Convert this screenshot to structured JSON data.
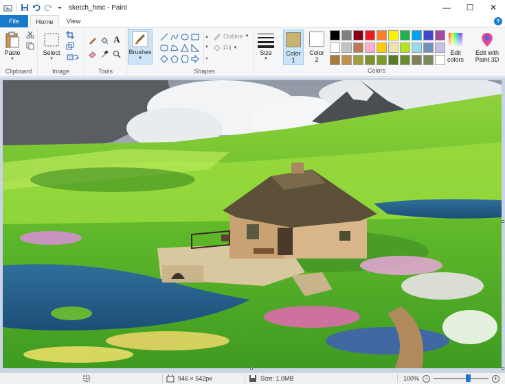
{
  "window": {
    "title": "sketch_hmc - Paint",
    "controls": {
      "minimize": "—",
      "maximize": "☐",
      "close": "✕"
    }
  },
  "quick_access": [
    "paint-app-icon",
    "save-icon",
    "undo-icon",
    "redo-icon",
    "customize-dropdown-icon"
  ],
  "tabs": {
    "file": "File",
    "home": "Home",
    "view": "View"
  },
  "help_glyph": "?",
  "ribbon": {
    "clipboard": {
      "label": "Clipboard",
      "paste": "Paste"
    },
    "image": {
      "label": "Image",
      "select": "Select"
    },
    "tools": {
      "label": "Tools"
    },
    "brushes": {
      "label": "Brushes"
    },
    "shapes": {
      "label": "Shapes",
      "outline": "Outline",
      "fill": "Fill"
    },
    "size": {
      "label": "Size"
    },
    "color1": {
      "label": "Color",
      "number": "1",
      "value": "#c8b46e"
    },
    "color2": {
      "label": "Color",
      "number": "2",
      "value": "#ffffff"
    },
    "colors": {
      "label": "Colors",
      "edit_line1": "Edit",
      "edit_line2": "colors"
    },
    "paint3d": {
      "line1": "Edit with",
      "line2": "Paint 3D"
    }
  },
  "palette": {
    "row1": [
      "#000000",
      "#7f7f7f",
      "#880015",
      "#ed1c24",
      "#ff7f27",
      "#fff200",
      "#22b14c",
      "#00a2e8",
      "#3f48cc",
      "#a349a4"
    ],
    "row2": [
      "#ffffff",
      "#c3c3c3",
      "#b97a57",
      "#ffaec9",
      "#ffc90e",
      "#efe4b0",
      "#b5e61d",
      "#99d9ea",
      "#7092be",
      "#c8bfe7"
    ],
    "row3": [
      "#a67c3e",
      "#c09050",
      "#a0a040",
      "#7f9030",
      "#809a2a",
      "#5a7a28",
      "#6a8c30",
      "#808060",
      "#7a8a5a",
      "#ffffff"
    ]
  },
  "status": {
    "dimensions": "946 × 542px",
    "size": "Size: 1.0MB",
    "zoom": "100%",
    "zoom_level": 0.62
  }
}
